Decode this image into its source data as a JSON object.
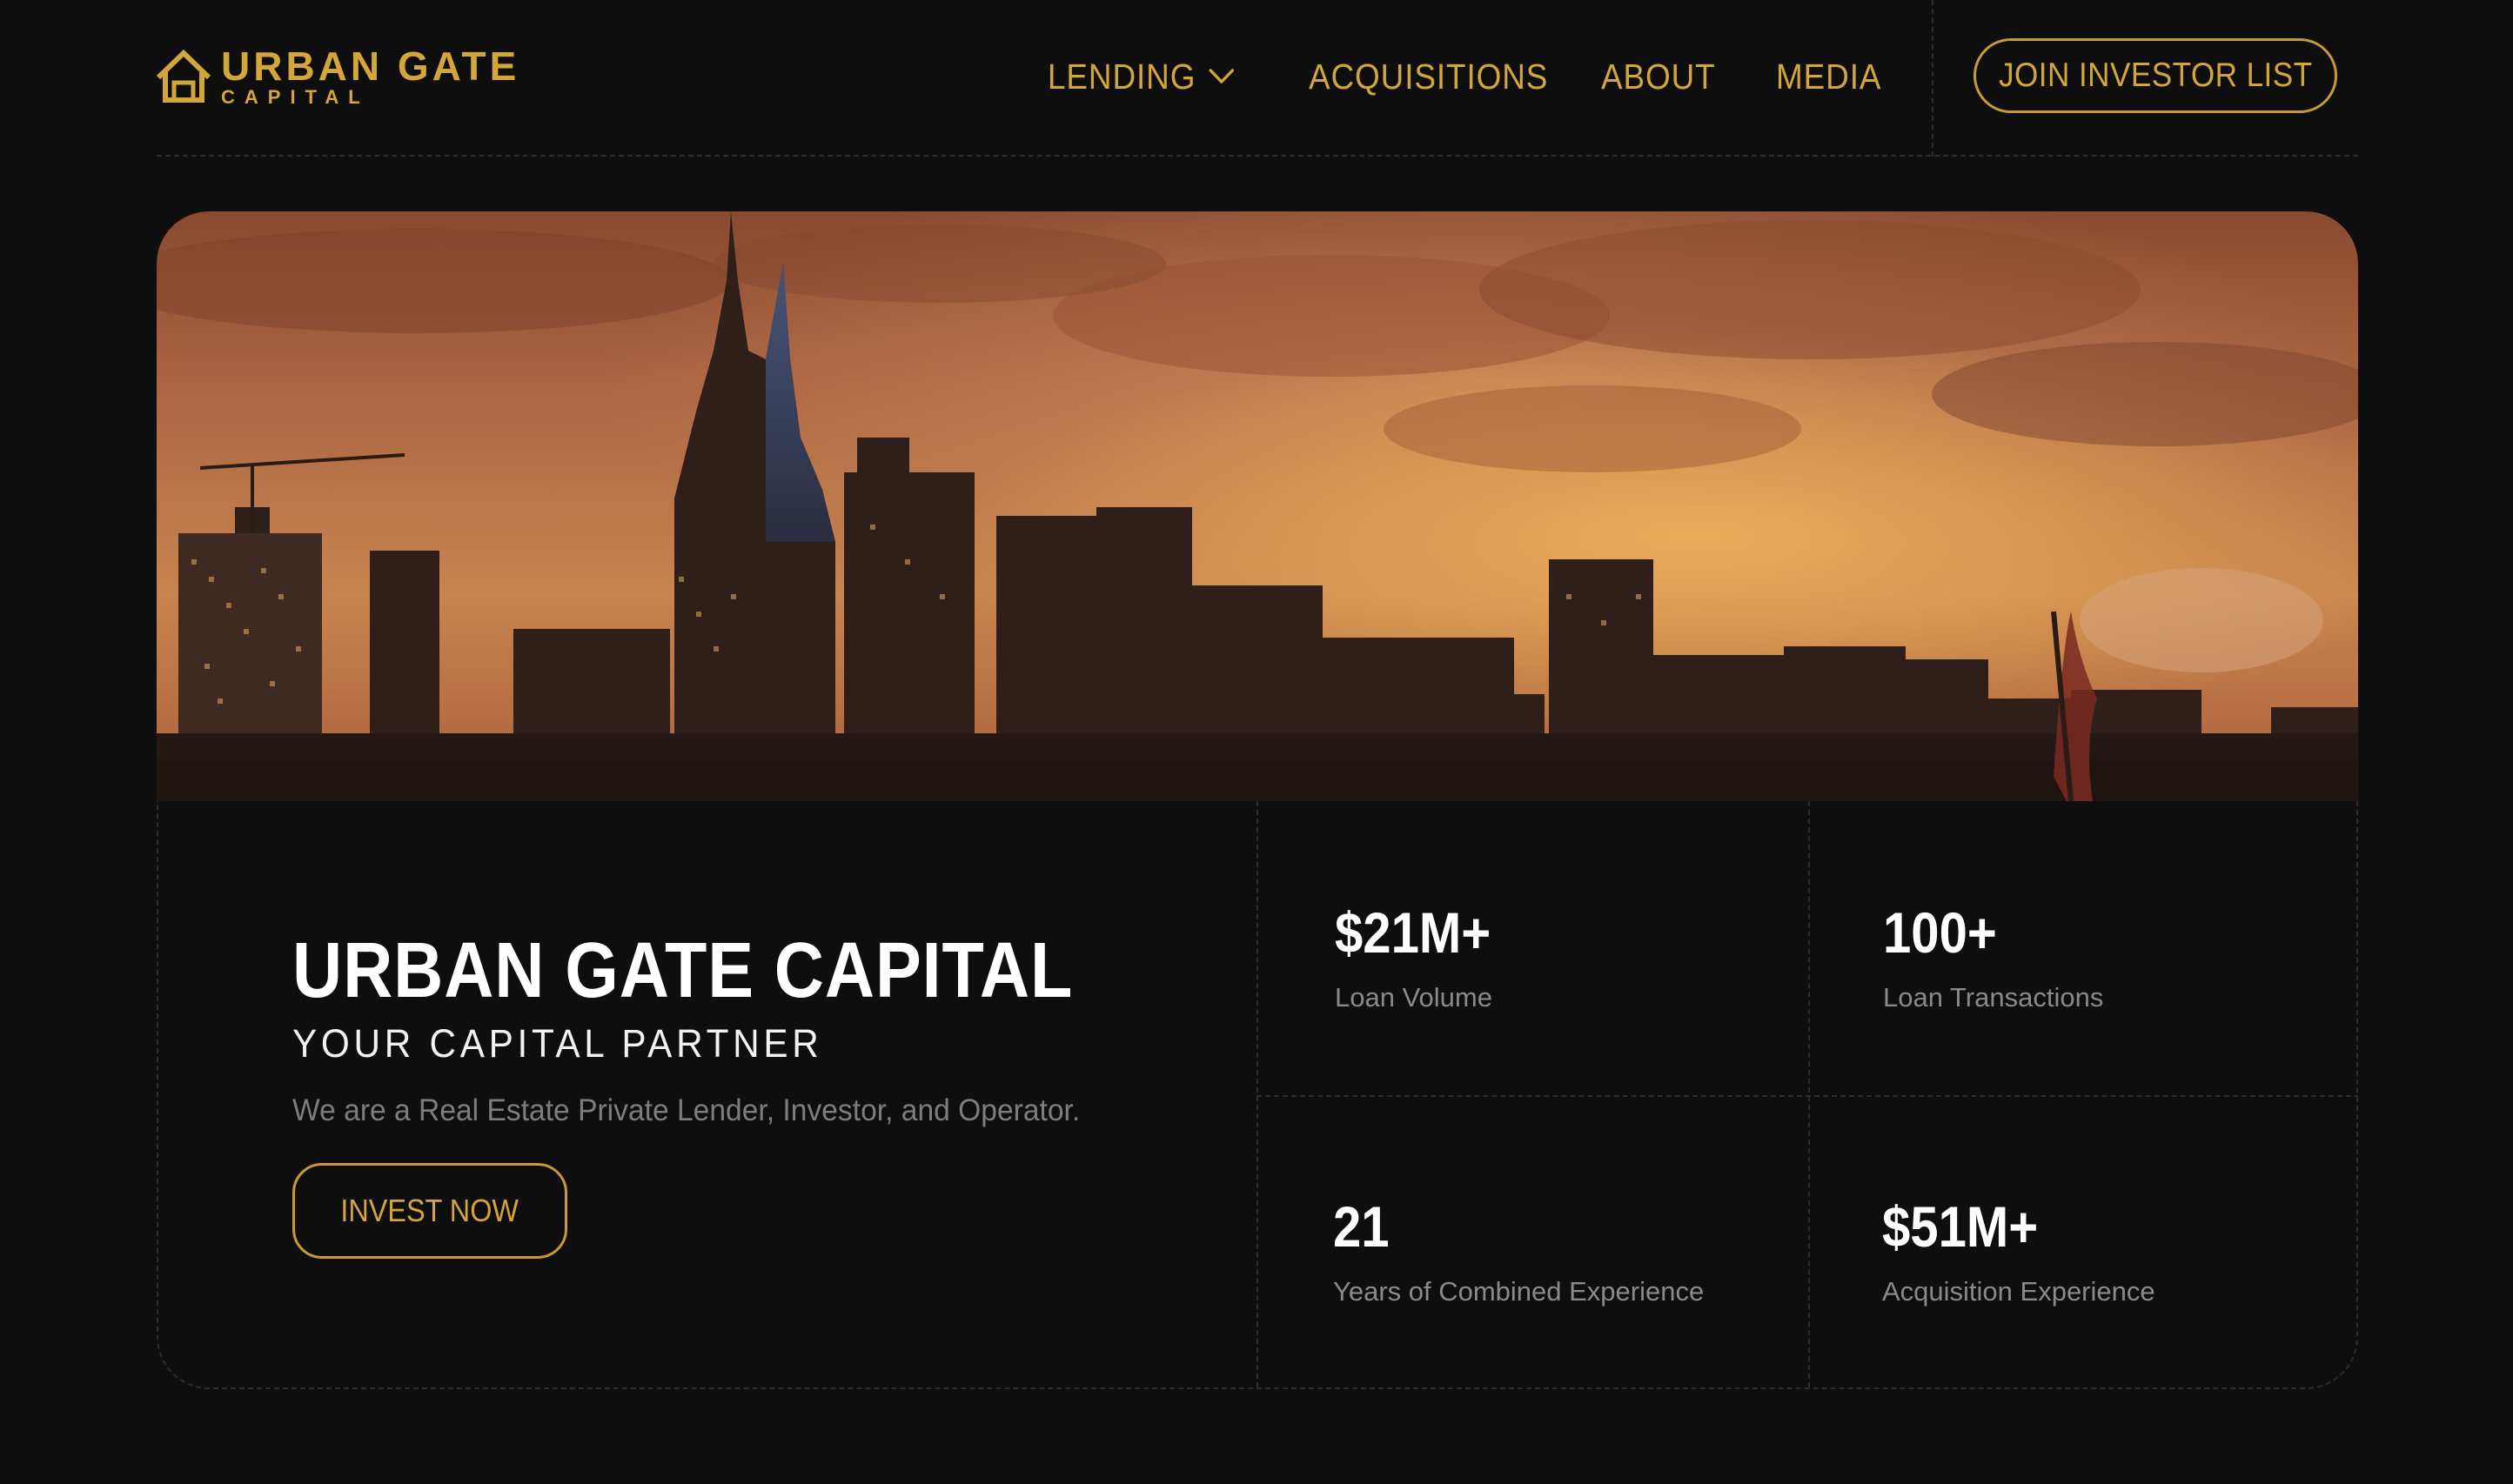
{
  "brand": {
    "name_line1": "URBAN GATE",
    "name_line2": "CAPITAL",
    "accent_color": "#d3a63a",
    "logo_icon": "house-gate-icon"
  },
  "nav": {
    "items": [
      {
        "label": "LENDING",
        "icon": "chevron-down-icon"
      },
      {
        "label": "ACQUISITIONS"
      },
      {
        "label": "ABOUT"
      },
      {
        "label": "MEDIA"
      }
    ],
    "cta_label": "JOIN INVESTOR LIST"
  },
  "hero": {
    "image_alt": "city-skyline-sunset-image",
    "title": "URBAN GATE CAPITAL",
    "subtitle": "YOUR CAPITAL PARTNER",
    "description": "We are a Real Estate Private Lender, Investor, and Operator.",
    "cta_label": "INVEST NOW"
  },
  "stats": [
    {
      "value": "$21M+",
      "label": "Loan Volume"
    },
    {
      "value": "100+",
      "label": "Loan Transactions"
    },
    {
      "value": "21",
      "label": "Years of Combined Experience"
    },
    {
      "value": "$51M+",
      "label": "Acquisition Experience"
    }
  ],
  "colors": {
    "background": "#0e0e0e",
    "text_primary": "#ffffff",
    "text_muted": "#8a8a8a"
  }
}
